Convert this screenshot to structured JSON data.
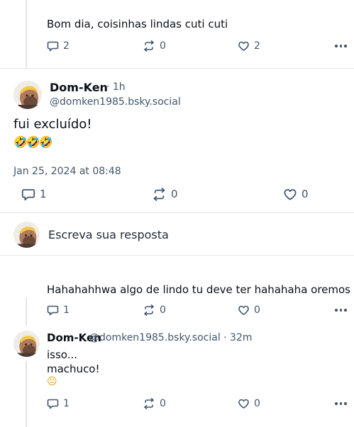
{
  "top_reply": {
    "text": "Bom dia, coisinhas lindas cuti cuti",
    "replies": "2",
    "reposts": "0",
    "likes": "2"
  },
  "main_post": {
    "author_name": "Dom-Ken",
    "time": "· 1h",
    "handle": "@domken1985.bsky.social",
    "text": "fui excluído!",
    "emoji": "🤣🤣🤣",
    "timestamp": "Jan 25, 2024 at 08:48",
    "replies": "1",
    "reposts": "0",
    "likes": "0"
  },
  "composer": {
    "placeholder": "Escreva sua resposta"
  },
  "reply_1": {
    "text": "Hahahahhwa algo de lindo tu deve ter hahahaha oremos",
    "replies": "1",
    "reposts": "0",
    "likes": "0"
  },
  "reply_2": {
    "author_name": "Dom-Ken",
    "meta": "@domken1985.bsky.social · 32m",
    "line1": "isso...",
    "line2": "machuco!",
    "emoji": "😐",
    "replies": "1",
    "reposts": "0",
    "likes": "0"
  },
  "icons": {
    "reply": "speech-bubble-icon",
    "repost": "repost-arrows-icon",
    "like": "heart-icon",
    "more": "more-dots-icon"
  },
  "colors": {
    "muted": "#42576c",
    "divider": "#e4e8ec",
    "thread_line": "#e1e6ec"
  }
}
